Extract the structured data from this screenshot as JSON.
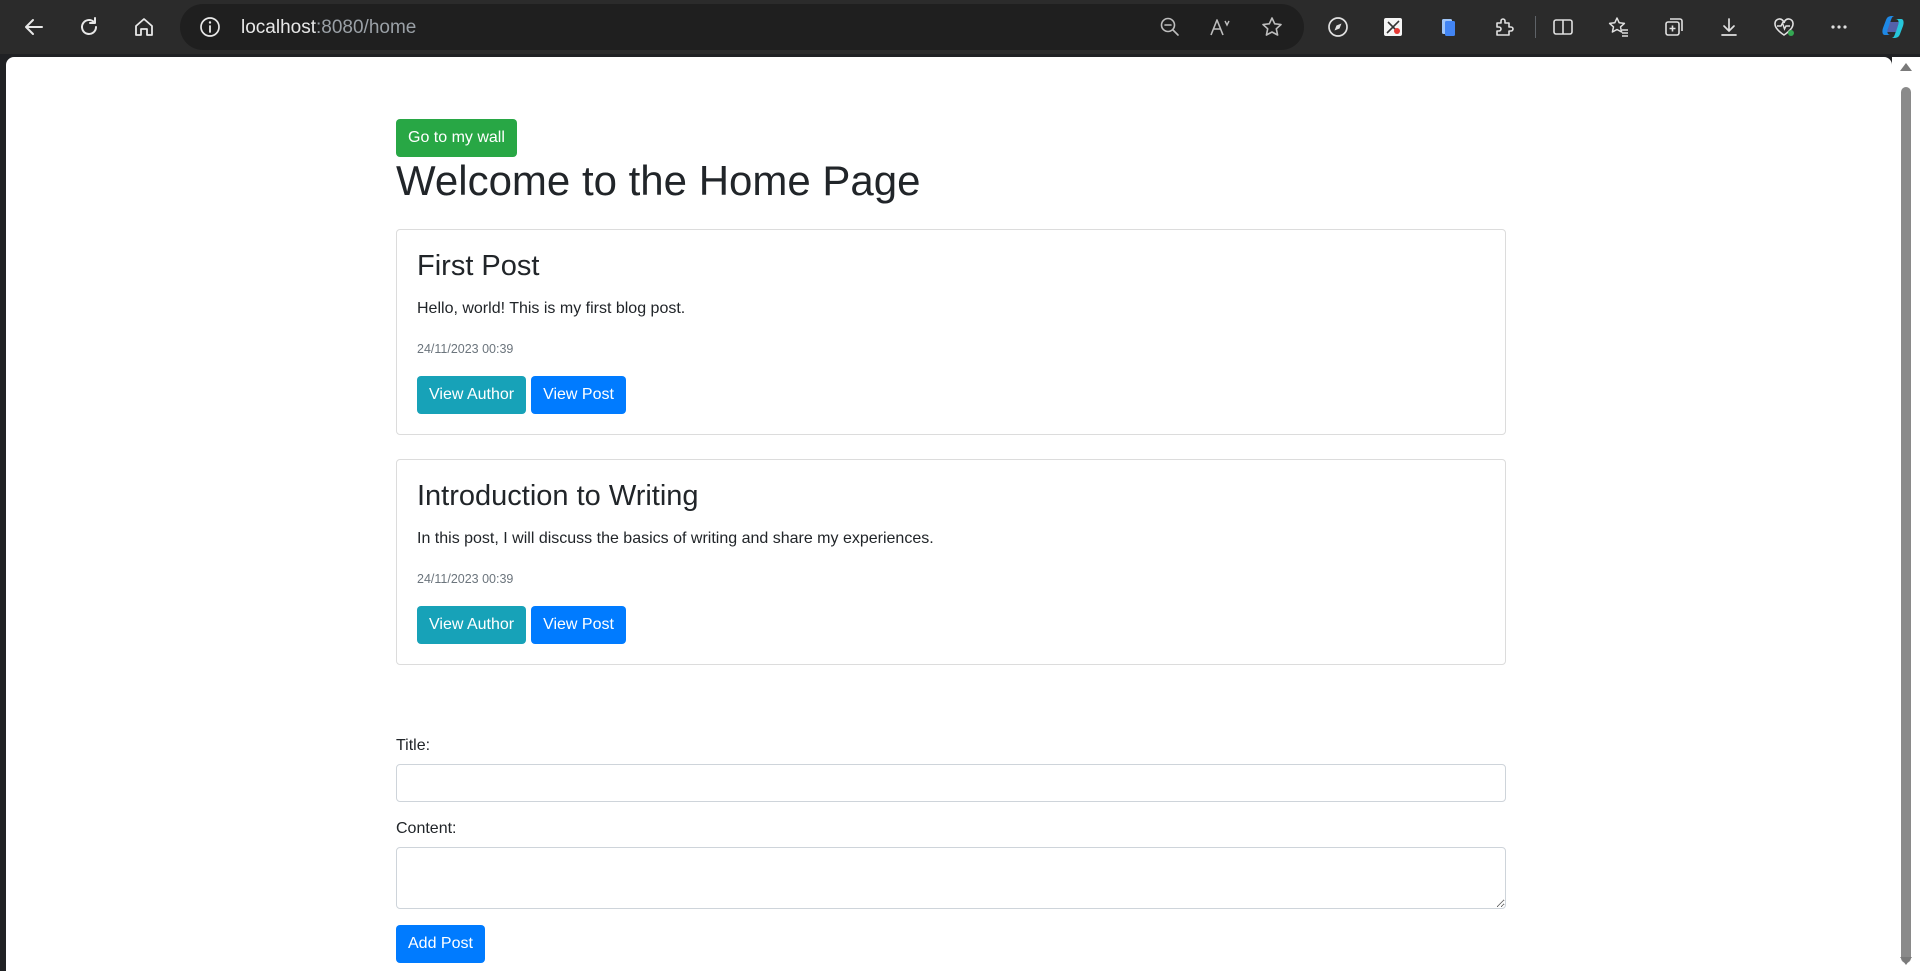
{
  "browser": {
    "url_host": "localhost",
    "url_rest": ":8080/home"
  },
  "page": {
    "wall_button": "Go to my wall",
    "title": "Welcome to the Home Page"
  },
  "posts": [
    {
      "title": "First Post",
      "content": "Hello, world! This is my first blog post.",
      "date": "24/11/2023 00:39",
      "author_button": "View Author",
      "post_button": "View Post"
    },
    {
      "title": "Introduction to Writing",
      "content": "In this post, I will discuss the basics of writing and share my experiences.",
      "date": "24/11/2023 00:39",
      "author_button": "View Author",
      "post_button": "View Post"
    }
  ],
  "form": {
    "title_label": "Title:",
    "title_value": "",
    "content_label": "Content:",
    "content_value": "",
    "submit_label": "Add Post"
  },
  "colors": {
    "success": "#28a745",
    "info": "#17a2b8",
    "primary": "#007bff"
  },
  "icons": {
    "back": "back-icon",
    "refresh": "refresh-icon",
    "home": "home-icon",
    "site_info": "info-icon",
    "zoom": "zoom-out-icon",
    "read_aloud": "read-aloud-icon",
    "favorite": "star-icon",
    "extensions": "puzzle-icon",
    "split": "split-screen-icon",
    "favorites": "favorites-icon",
    "collections": "collections-icon",
    "downloads": "download-icon",
    "health": "browser-essentials-icon",
    "more": "more-icon",
    "copilot": "copilot-icon"
  }
}
